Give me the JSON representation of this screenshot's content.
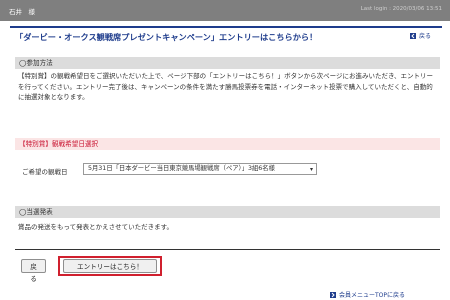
{
  "topbar": {
    "user_text": "石井　様",
    "last_login": "Last login : 2020/03/06 13:51"
  },
  "header": {
    "title": "「ダービー・オークス観戦席プレゼントキャンペーン」エントリーはこちらから！",
    "back_label": "戻る"
  },
  "sections": {
    "participation": {
      "heading": "◯参加方法",
      "body": "【特別賞】の観戦希望日をご選択いただいた上で、ページ下部の「エントリーはこちら！」ボタンから次ページにお進みいただき、エントリーを行ってください。エントリー完了後は、キャンペーンの条件を満たす勝馬投票券を電話・インターネット投票で購入していただくと、自動的に抽選対象となります。"
    },
    "special": {
      "heading": "【特別賞】観戦希望日選択",
      "field_label": "ご希望の観戦日",
      "selected_option": "5月31日「日本ダービー当日東京競馬場観戦席（ペア）」3組6名様"
    },
    "announcement": {
      "heading": "◯当選発表",
      "body": "賞品の発送をもって発表とかえさせていただきます。"
    }
  },
  "buttons": {
    "back": "戻る",
    "entry": "エントリーはこちら！"
  },
  "footer": {
    "top_link": "会員メニューTOPに戻る"
  },
  "colors": {
    "topbar": "#7f7f7f",
    "title": "#1e3c8c",
    "accent_red": "#d0202e",
    "section_grey": "#dcdcdc",
    "section_pink": "#fbe5e5"
  }
}
